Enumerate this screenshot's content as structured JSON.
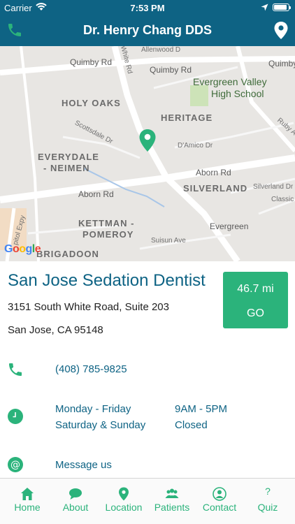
{
  "status_bar": {
    "carrier": "Carrier",
    "time": "7:53 PM",
    "battery_level": 0.92
  },
  "header": {
    "title": "Dr. Henry Chang DDS",
    "left_icon": "phone-icon",
    "right_icon": "location-pin-icon",
    "color": "#0e6384"
  },
  "map": {
    "labels": {
      "quimby_rd_1": "Quimby Rd",
      "quimby_rd_2": "Quimby Rd",
      "quimby_rd_3": "Quimby",
      "allenwood": "Allenwood D",
      "school_1": "Evergreen Valley",
      "school_2": "High School",
      "holy_oaks": "HOLY OAKS",
      "heritage": "HERITAGE",
      "everydale_1": "EVERYDALE",
      "everydale_2": "- NEIMEN",
      "scottsdale": "Scottsdale Dr",
      "damico": "D'Amico Dr",
      "abom_rd_1": "Aborn Rd",
      "abom_rd_2": "Aborn Rd",
      "silverland": "SILVERLAND",
      "silverland_dr": "Silverland Dr",
      "classic": "Classic",
      "kettman_1": "KETTMAN -",
      "kettman_2": "POMEROY",
      "evergreen": "Evergreen",
      "suisun": "Suisun Ave",
      "brigadoon": "BRIGADOON",
      "white_rd": "White Rd",
      "capitol": "pitol Expy",
      "ruby": "Ruby A"
    },
    "google_logo": "Google"
  },
  "practice": {
    "name": "San Jose Sedation Dentist",
    "address_line1": "3151 South White Road, Suite 203",
    "address_line2": "San Jose, CA 95148",
    "distance": "46.7 mi",
    "go_label": "GO",
    "phone": "(408) 785-9825",
    "hours": [
      {
        "days": "Monday - Friday",
        "time": "9AM - 5PM"
      },
      {
        "days": "Saturday & Sunday",
        "time": "Closed"
      }
    ],
    "message": "Message us"
  },
  "colors": {
    "brand": "#0e6384",
    "accent": "#2bb37b"
  },
  "tabs": [
    {
      "label": "Home",
      "icon": "home-icon"
    },
    {
      "label": "About",
      "icon": "chat-bubble-icon"
    },
    {
      "label": "Location",
      "icon": "location-pin-icon"
    },
    {
      "label": "Patients",
      "icon": "people-icon"
    },
    {
      "label": "Contact",
      "icon": "person-circle-icon"
    },
    {
      "label": "Quiz",
      "icon": "question-mark-icon",
      "glyph": "?"
    }
  ]
}
